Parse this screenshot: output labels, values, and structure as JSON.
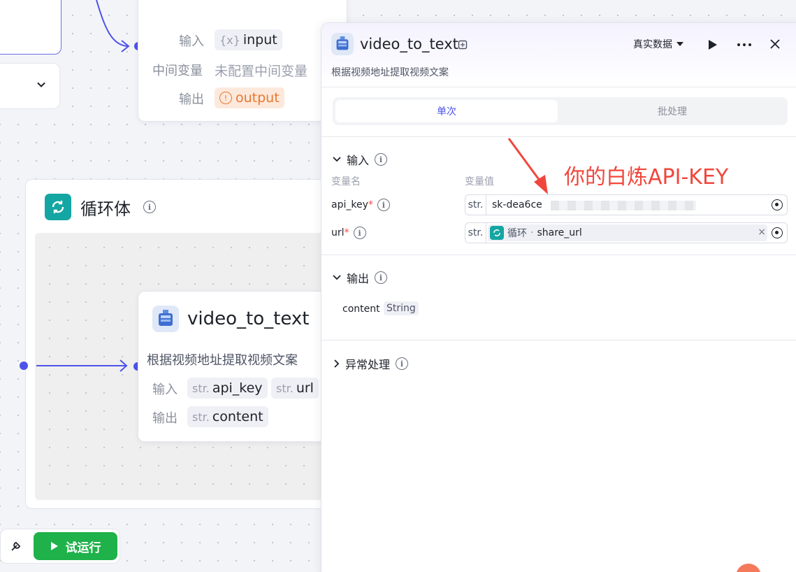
{
  "canvas": {
    "upper_node": {
      "input_label": "输入",
      "input_tag_prefix": "{x}",
      "input_tag": "input",
      "mid_label": "中间变量",
      "mid_value": "未配置中间变量",
      "output_label": "输出",
      "output_tag": "output",
      "output_warn_glyph": "!"
    },
    "loop": {
      "title": "循环体",
      "info_glyph": "i"
    },
    "inner_node": {
      "title": "video_to_text",
      "description": "根据视频地址提取视频文案",
      "input_label": "输入",
      "output_label": "输出",
      "str_prefix": "str.",
      "inputs": [
        "api_key",
        "url"
      ],
      "outputs": [
        "content"
      ]
    },
    "toolbar": {
      "run_label": "试运行"
    }
  },
  "panel": {
    "title": "video_to_text",
    "description": "根据视频地址提取视频文案",
    "data_mode": "真实数据",
    "tabs": [
      "单次",
      "批处理"
    ],
    "input_section": {
      "title": "输入",
      "col_name": "变量名",
      "col_value": "变量值",
      "fields": [
        {
          "name": "api_key",
          "required_mark": "*",
          "type": "str.",
          "value": "sk-dea6ce"
        },
        {
          "name": "url",
          "required_mark": "*",
          "type": "str.",
          "ref_source": "循环",
          "ref_sep": "·",
          "ref_var": "share_url",
          "clear_glyph": "×"
        }
      ]
    },
    "output_section": {
      "title": "输出",
      "fields": [
        {
          "name": "content",
          "type": "String"
        }
      ]
    },
    "exception_section": {
      "title": "异常处理"
    }
  },
  "annotation": {
    "text": "你的白炼API-KEY",
    "color": "#f0473c"
  },
  "colors": {
    "accent": "#4d53e8",
    "run_green": "#1fb14a",
    "loop_teal": "#14a6a2",
    "warn_orange": "#e8762e"
  }
}
